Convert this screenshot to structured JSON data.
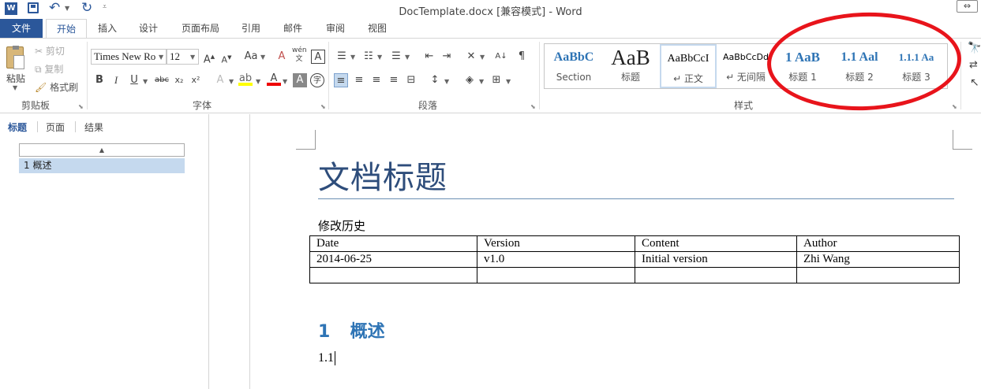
{
  "window": {
    "title": "DocTemplate.docx [兼容模式] - Word"
  },
  "tabs": [
    {
      "label": "文件"
    },
    {
      "label": "开始"
    },
    {
      "label": "插入"
    },
    {
      "label": "设计"
    },
    {
      "label": "页面布局"
    },
    {
      "label": "引用"
    },
    {
      "label": "邮件"
    },
    {
      "label": "审阅"
    },
    {
      "label": "视图"
    }
  ],
  "clipboard": {
    "paste": "粘贴",
    "cut": "剪切",
    "copy": "复制",
    "format_painter": "格式刷",
    "group": "剪贴板"
  },
  "font": {
    "name": "Times New Ro",
    "size": "12",
    "group": "字体",
    "case": "Aa",
    "bold": "B",
    "italic": "I",
    "underline": "U",
    "strike": "abc",
    "sub": "x₂",
    "sup": "x²",
    "wen": "wén",
    "char_border": "A"
  },
  "paragraph": {
    "group": "段落"
  },
  "styles": {
    "group": "样式",
    "items": [
      {
        "preview": "AaBbC",
        "name": "Section"
      },
      {
        "preview": "AaB",
        "name": "标题"
      },
      {
        "preview": "AaBbCcI",
        "name": "↵ 正文"
      },
      {
        "preview": "AaBbCcDd",
        "name": "↵ 无间隔"
      },
      {
        "preview": "1  AaB",
        "name": "标题 1"
      },
      {
        "preview": "1.1  Aal",
        "name": "标题 2"
      },
      {
        "preview": "1.1.1  Aa",
        "name": "标题 3"
      }
    ]
  },
  "nav": {
    "tabs": [
      "标题",
      "页面",
      "结果"
    ],
    "items": [
      "1 概述"
    ]
  },
  "document": {
    "title": "文档标题",
    "history_label": "修改历史",
    "table": {
      "headers": [
        "Date",
        "Version",
        "Content",
        "Author"
      ],
      "rows": [
        [
          "2014-06-25",
          "v1.0",
          "Initial version",
          "Zhi Wang"
        ],
        [
          "",
          "",
          "",
          ""
        ]
      ]
    },
    "heading1": {
      "number": "1",
      "text": "概述"
    },
    "body_text": "1.1"
  },
  "colors": {
    "accent": "#2b579a",
    "heading": "#2e74b5",
    "annotation": "#e8141b"
  }
}
